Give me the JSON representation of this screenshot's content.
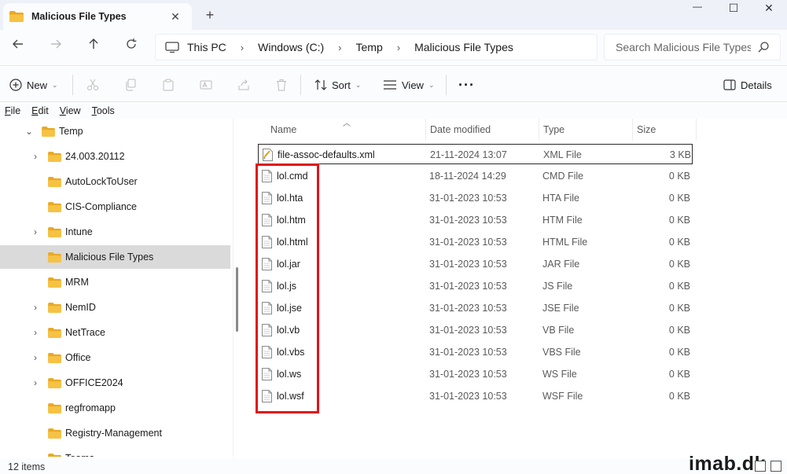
{
  "window": {
    "tab_title": "Malicious File Types",
    "new_tab": "+",
    "minimize": "—",
    "maximize": "☐",
    "close": "✕"
  },
  "address": {
    "crumbs": [
      "This PC",
      "Windows (C:)",
      "Temp",
      "Malicious File Types"
    ],
    "search_placeholder": "Search Malicious File Types"
  },
  "commands": {
    "new": "New",
    "sort": "Sort",
    "view": "View",
    "more": "···",
    "details": "Details"
  },
  "menu": [
    "File",
    "Edit",
    "View",
    "Tools"
  ],
  "nav_tree": [
    {
      "label": "Temp",
      "chevron": "down",
      "indent": 0,
      "selected": false
    },
    {
      "label": "24.003.20112",
      "chevron": "right",
      "indent": 1,
      "selected": false
    },
    {
      "label": "AutoLockToUser",
      "chevron": "",
      "indent": 1,
      "selected": false
    },
    {
      "label": "CIS-Compliance",
      "chevron": "",
      "indent": 1,
      "selected": false
    },
    {
      "label": "Intune",
      "chevron": "right",
      "indent": 1,
      "selected": false
    },
    {
      "label": "Malicious File Types",
      "chevron": "",
      "indent": 1,
      "selected": true
    },
    {
      "label": "MRM",
      "chevron": "",
      "indent": 1,
      "selected": false
    },
    {
      "label": "NemID",
      "chevron": "right",
      "indent": 1,
      "selected": false
    },
    {
      "label": "NetTrace",
      "chevron": "right",
      "indent": 1,
      "selected": false
    },
    {
      "label": "Office",
      "chevron": "right",
      "indent": 1,
      "selected": false
    },
    {
      "label": "OFFICE2024",
      "chevron": "right",
      "indent": 1,
      "selected": false
    },
    {
      "label": "regfromapp",
      "chevron": "",
      "indent": 1,
      "selected": false
    },
    {
      "label": "Registry-Management",
      "chevron": "",
      "indent": 1,
      "selected": false
    },
    {
      "label": "Teams",
      "chevron": "",
      "indent": 1,
      "selected": false
    }
  ],
  "columns": [
    "Name",
    "Date modified",
    "Type",
    "Size"
  ],
  "files": [
    {
      "name": "file-assoc-defaults.xml",
      "date": "21-11-2024 13:07",
      "type": "XML File",
      "size": "3 KB",
      "icon": "xml-file-icon"
    },
    {
      "name": "lol.cmd",
      "date": "18-11-2024 14:29",
      "type": "CMD File",
      "size": "0 KB",
      "icon": "file-icon"
    },
    {
      "name": "lol.hta",
      "date": "31-01-2023 10:53",
      "type": "HTA File",
      "size": "0 KB",
      "icon": "file-icon"
    },
    {
      "name": "lol.htm",
      "date": "31-01-2023 10:53",
      "type": "HTM File",
      "size": "0 KB",
      "icon": "file-icon"
    },
    {
      "name": "lol.html",
      "date": "31-01-2023 10:53",
      "type": "HTML File",
      "size": "0 KB",
      "icon": "file-icon"
    },
    {
      "name": "lol.jar",
      "date": "31-01-2023 10:53",
      "type": "JAR File",
      "size": "0 KB",
      "icon": "file-icon"
    },
    {
      "name": "lol.js",
      "date": "31-01-2023 10:53",
      "type": "JS File",
      "size": "0 KB",
      "icon": "file-icon"
    },
    {
      "name": "lol.jse",
      "date": "31-01-2023 10:53",
      "type": "JSE File",
      "size": "0 KB",
      "icon": "file-icon"
    },
    {
      "name": "lol.vb",
      "date": "31-01-2023 10:53",
      "type": "VB File",
      "size": "0 KB",
      "icon": "file-icon"
    },
    {
      "name": "lol.vbs",
      "date": "31-01-2023 10:53",
      "type": "VBS File",
      "size": "0 KB",
      "icon": "file-icon"
    },
    {
      "name": "lol.ws",
      "date": "31-01-2023 10:53",
      "type": "WS File",
      "size": "0 KB",
      "icon": "file-icon"
    },
    {
      "name": "lol.wsf",
      "date": "31-01-2023 10:53",
      "type": "WSF File",
      "size": "0 KB",
      "icon": "file-icon"
    }
  ],
  "status": {
    "item_count": "12 items",
    "watermark": "imab.dk"
  },
  "colors": {
    "folder": "#f6c244",
    "highlight_box": "#e0121a",
    "selected_bg": "#dadada"
  }
}
